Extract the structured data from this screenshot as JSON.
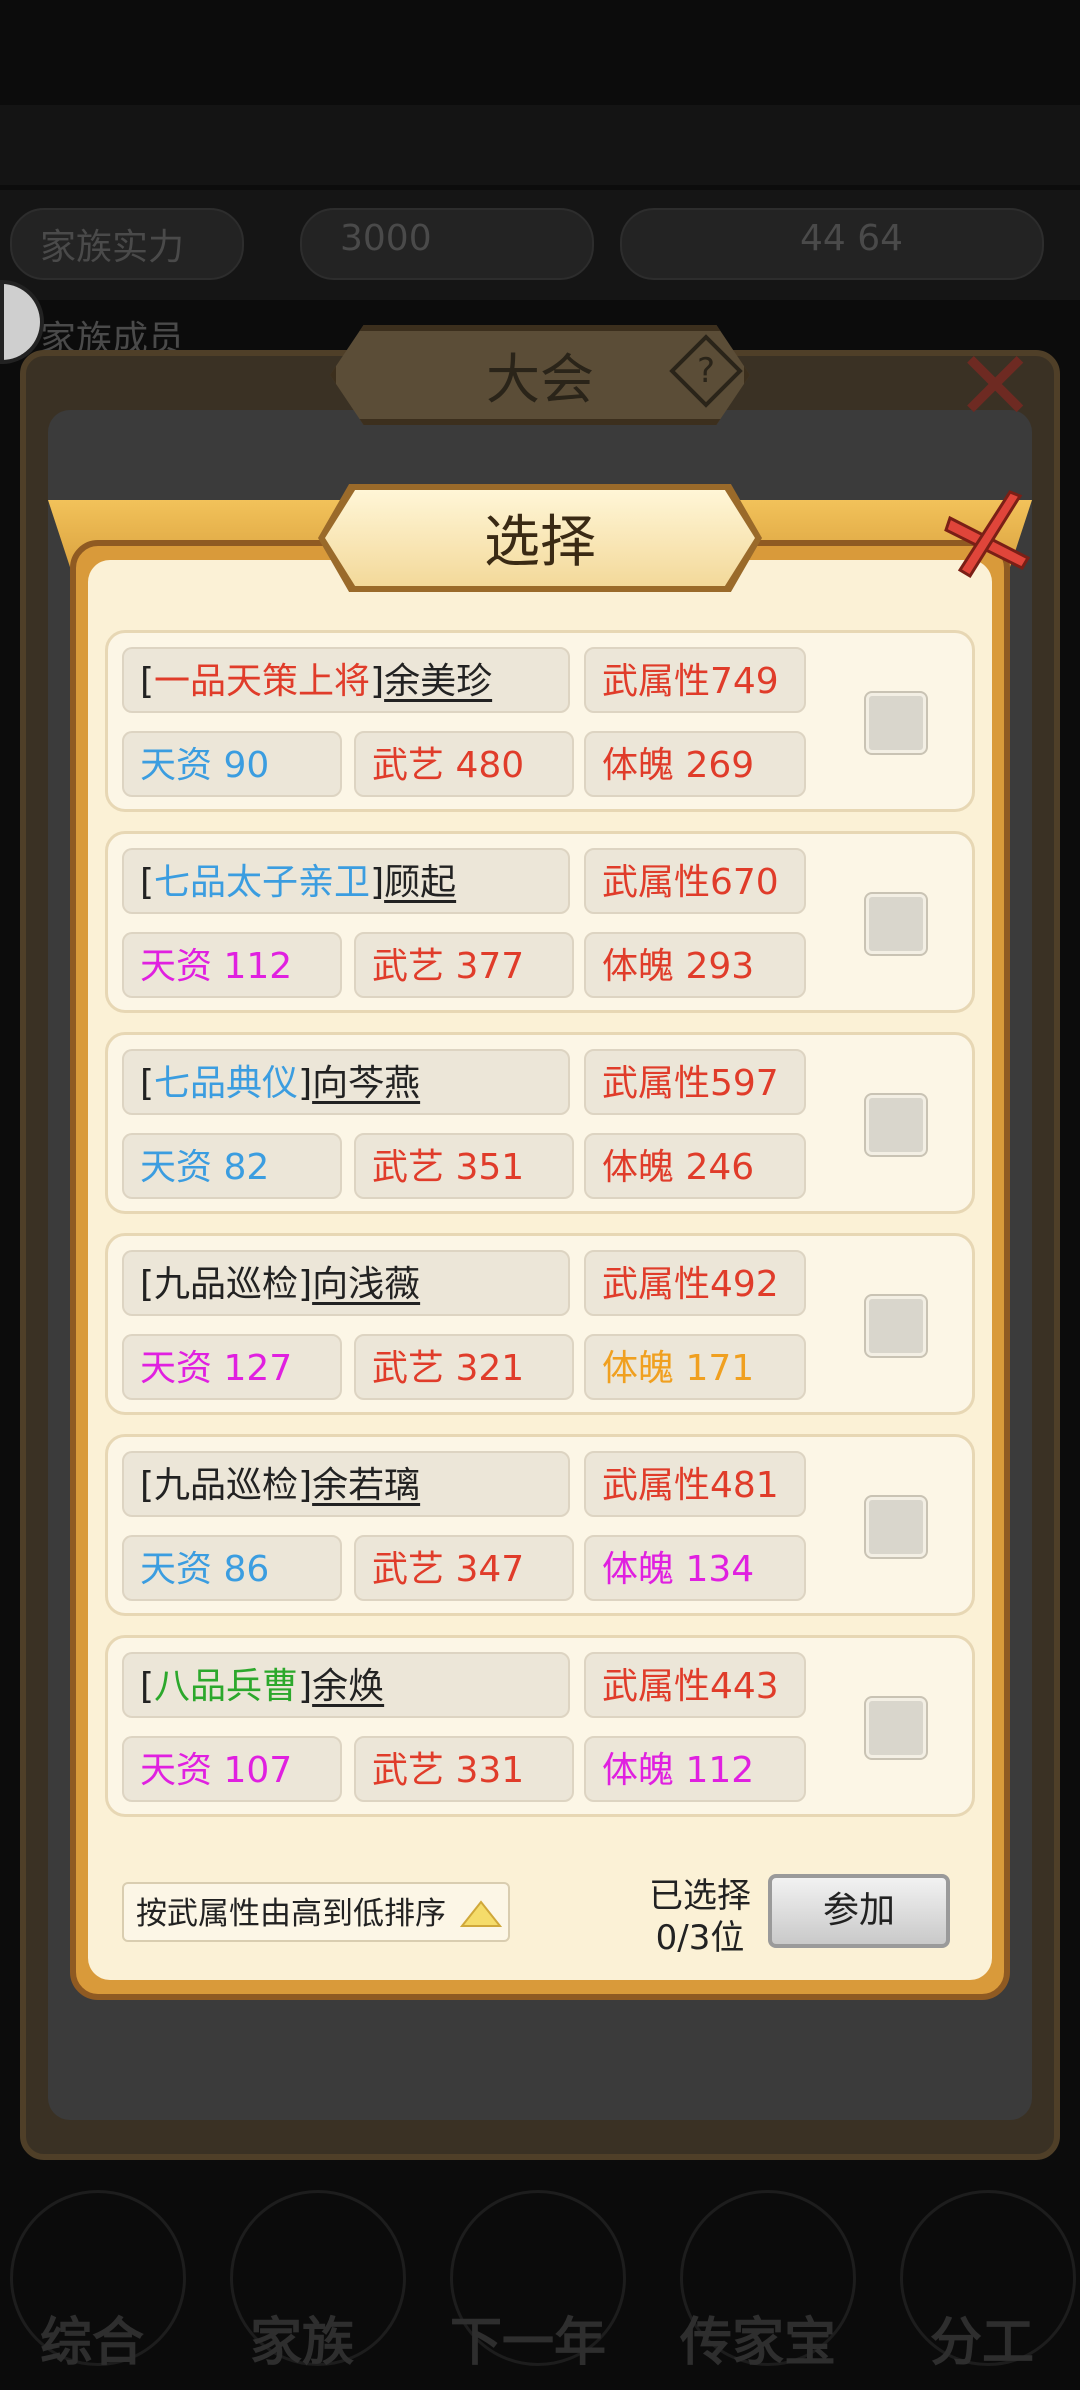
{
  "background": {
    "top_left": "家族实力",
    "top_mid": "3000",
    "top_right": "44 64",
    "row2_left": "家族成员",
    "nav": [
      "综合",
      "家族",
      "下一年",
      "传家宝",
      "分工"
    ]
  },
  "outer_dialog": {
    "title": "大会",
    "help_label": "?"
  },
  "dialog": {
    "title": "选择",
    "close_label": "✕",
    "candidates": [
      {
        "rank": "一品天策上将",
        "name": "余美珍",
        "wu_shuxing": "武属性749",
        "tianzi": "天资 90",
        "wuyi": "武艺 480",
        "tipo": "体魄 269",
        "rank_color": "#e03c2a",
        "tianzi_color": "#3b9de0",
        "tipo_color": "#e03c2a"
      },
      {
        "rank": "七品太子亲卫",
        "name": "顾起",
        "wu_shuxing": "武属性670",
        "tianzi": "天资 112",
        "wuyi": "武艺 377",
        "tipo": "体魄 293",
        "rank_color": "#3b9de0",
        "tianzi_color": "#e020e0",
        "tipo_color": "#e03c2a"
      },
      {
        "rank": "七品典仪",
        "name": "向芩燕",
        "wu_shuxing": "武属性597",
        "tianzi": "天资 82",
        "wuyi": "武艺 351",
        "tipo": "体魄 246",
        "rank_color": "#3b9de0",
        "tianzi_color": "#3b9de0",
        "tipo_color": "#e03c2a"
      },
      {
        "rank": "九品巡检",
        "name": "向浅薇",
        "wu_shuxing": "武属性492",
        "tianzi": "天资 127",
        "wuyi": "武艺 321",
        "tipo": "体魄 171",
        "rank_color": "#222222",
        "tianzi_color": "#e020e0",
        "tipo_color": "#f0a020"
      },
      {
        "rank": "九品巡检",
        "name": "余若璃",
        "wu_shuxing": "武属性481",
        "tianzi": "天资 86",
        "wuyi": "武艺 347",
        "tipo": "体魄 134",
        "rank_color": "#222222",
        "tianzi_color": "#3b9de0",
        "tipo_color": "#e020e0"
      },
      {
        "rank": "八品兵曹",
        "name": "余焕",
        "wu_shuxing": "武属性443",
        "tianzi": "天资 107",
        "wuyi": "武艺 331",
        "tipo": "体魄 112",
        "rank_color": "#2ca82c",
        "tianzi_color": "#e020e0",
        "tipo_color": "#e020e0"
      }
    ],
    "sort_label": "按武属性由高到低排序",
    "selected_label": "已选择",
    "selected_count": "0/3位",
    "join_label": "参加"
  }
}
